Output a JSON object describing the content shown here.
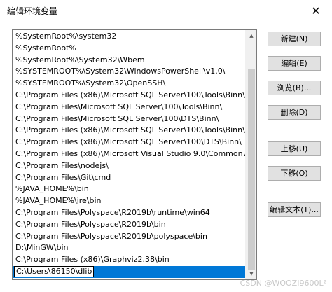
{
  "window": {
    "title": "编辑环境变量",
    "close_glyph": "✕"
  },
  "paths": [
    "%SystemRoot%\\system32",
    "%SystemRoot%",
    "%SystemRoot%\\System32\\Wbem",
    "%SYSTEMROOT%\\System32\\WindowsPowerShell\\v1.0\\",
    "%SYSTEMROOT%\\System32\\OpenSSH\\",
    "C:\\Program Files (x86)\\Microsoft SQL Server\\100\\Tools\\Binn\\",
    "C:\\Program Files\\Microsoft SQL Server\\100\\Tools\\Binn\\",
    "C:\\Program Files\\Microsoft SQL Server\\100\\DTS\\Binn\\",
    "C:\\Program Files (x86)\\Microsoft SQL Server\\100\\Tools\\Binn\\V...",
    "C:\\Program Files (x86)\\Microsoft SQL Server\\100\\DTS\\Binn\\",
    "C:\\Program Files (x86)\\Microsoft Visual Studio 9.0\\Common7\\...",
    "C:\\Program Files\\nodejs\\",
    "C:\\Program Files\\Git\\cmd",
    "%JAVA_HOME%\\bin",
    "%JAVA_HOME%\\jre\\bin",
    "C:\\Program Files\\Polyspace\\R2019b\\runtime\\win64",
    "C:\\Program Files\\Polyspace\\R2019b\\bin",
    "C:\\Program Files\\Polyspace\\R2019b\\polyspace\\bin",
    "D:\\MinGW\\bin",
    "C:\\Program Files (x86)\\Graphviz2.38\\bin"
  ],
  "editing": {
    "value": "C:\\Users\\86150\\dlib"
  },
  "buttons": {
    "new": "新建(N)",
    "edit": "编辑(E)",
    "browse": "浏览(B)...",
    "delete": "删除(D)",
    "move_up": "上移(U)",
    "move_down": "下移(O)",
    "edit_text": "编辑文本(T)..."
  },
  "watermark": "CSDN @WOOZI9600L²",
  "colors": {
    "selection": "#0078d7",
    "button_face": "#e1e1e1"
  }
}
